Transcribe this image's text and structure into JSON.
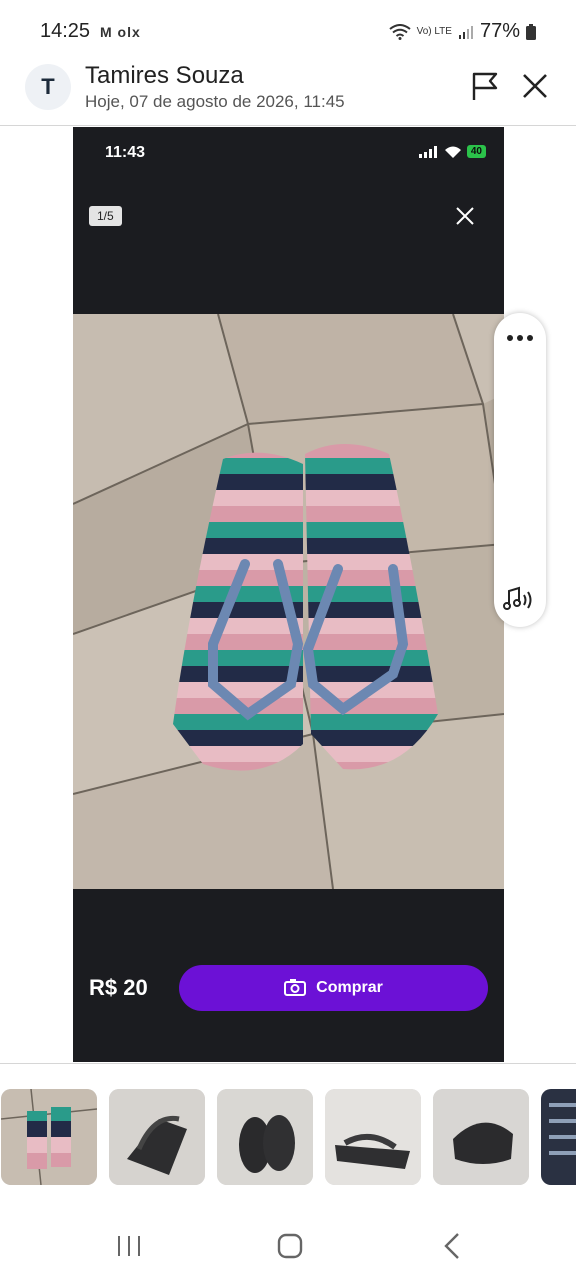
{
  "statusbar": {
    "time": "14:25",
    "app_icons": "M olx",
    "volte": "Vo) LTE",
    "battery": "77%"
  },
  "header": {
    "avatar_letter": "T",
    "name": "Tamires Souza",
    "date": "Hoje, 07 de agosto de 2026, 11:45"
  },
  "viewer": {
    "time": "11:43",
    "battery_badge": "40",
    "counter": "1/5",
    "price": "R$ 20",
    "buy_label": "Comprar",
    "buy_color": "#6c11d6"
  },
  "product": {
    "sandal_colors": [
      "#d99aa8",
      "#2a9b8a",
      "#222b47",
      "#e8bcc4"
    ],
    "strap_color": "#6c88b2"
  },
  "thumbnails": [
    {
      "name": "striped-sandals"
    },
    {
      "name": "black-sandals-side"
    },
    {
      "name": "black-sandals-top"
    },
    {
      "name": "black-sandals-heel"
    },
    {
      "name": "black-sandals-wall"
    },
    {
      "name": "chat-screenshot"
    }
  ],
  "icons": [
    "flag-icon",
    "close-icon",
    "more-icon",
    "audio-icon",
    "camera-money-icon",
    "recents-icon",
    "home-icon",
    "back-icon"
  ]
}
